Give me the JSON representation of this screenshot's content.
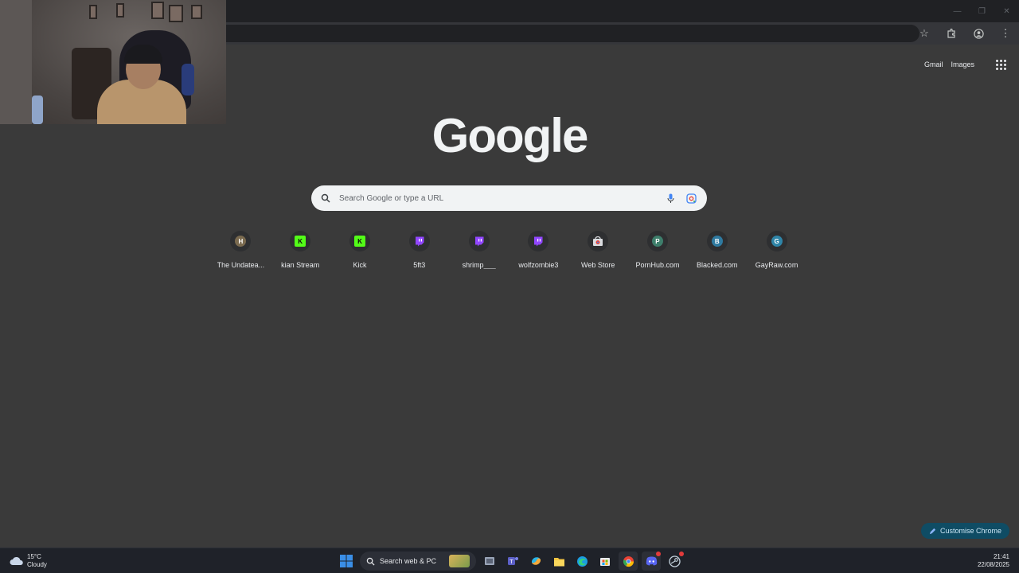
{
  "header": {
    "gmail": "Gmail",
    "images": "Images"
  },
  "logo": "Google",
  "search": {
    "placeholder": "Search Google or type a URL"
  },
  "shortcuts": [
    {
      "label": "The Undatea...",
      "letter": "H",
      "color": "#7a6a4f",
      "icon": "letter-icon"
    },
    {
      "label": "kian Stream",
      "letter": "K",
      "color": "#53fc18",
      "icon": "kick-icon"
    },
    {
      "label": "Kick",
      "letter": "K",
      "color": "#53fc18",
      "icon": "kick-icon"
    },
    {
      "label": "5ft3",
      "letter": "",
      "color": "#9146ff",
      "icon": "twitch-icon"
    },
    {
      "label": "shrimp___",
      "letter": "",
      "color": "#9146ff",
      "icon": "twitch-icon"
    },
    {
      "label": "wolfzombie3",
      "letter": "",
      "color": "#9146ff",
      "icon": "twitch-icon"
    },
    {
      "label": "Web Store",
      "letter": "",
      "color": "#e8eaed",
      "icon": "webstore-icon"
    },
    {
      "label": "PornHub.com",
      "letter": "P",
      "color": "#3e7e6b",
      "icon": "letter-icon"
    },
    {
      "label": "Blacked.com",
      "letter": "B",
      "color": "#2f7aa0",
      "icon": "letter-icon"
    },
    {
      "label": "GayRaw.com",
      "letter": "G",
      "color": "#2f85a8",
      "icon": "letter-icon"
    }
  ],
  "customise": {
    "label": "Customise Chrome"
  },
  "taskbar": {
    "weather_temp": "15°C",
    "weather_desc": "Cloudy",
    "search_label": "Search web & PC",
    "time": "21:41",
    "date": "22/08/2025"
  },
  "colors": {
    "page_bg": "#3a3a3a",
    "accent": "#0f4c64",
    "windows_blue": "#3a8ee6"
  }
}
